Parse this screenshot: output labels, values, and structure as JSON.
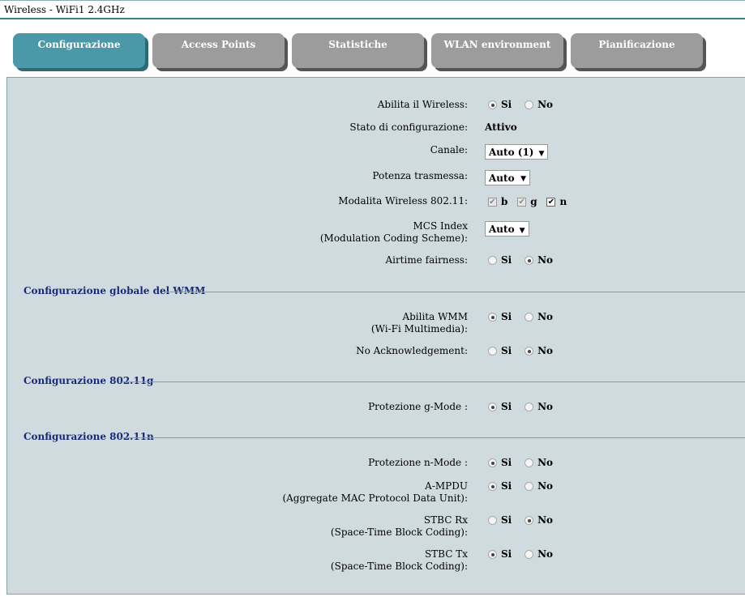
{
  "window_title": "Wireless - WiFi1 2.4GHz",
  "tabs": [
    {
      "label": "Configurazione",
      "active": true
    },
    {
      "label": "Access Points",
      "active": false
    },
    {
      "label": "Statistiche",
      "active": false
    },
    {
      "label": "WLAN environment",
      "active": false
    },
    {
      "label": "Pianificazione",
      "active": false
    }
  ],
  "options": {
    "yes": "Si",
    "no": "No"
  },
  "wireless": {
    "enable_label": "Abilita il Wireless:",
    "enable_value": "Si",
    "status_label": "Stato di configurazione:",
    "status_value": "Attivo",
    "channel_label": "Canale:",
    "channel_value": "Auto (1)",
    "power_label": "Potenza trasmessa:",
    "power_value": "Auto",
    "mode_label": "Modalita Wireless 802.11:",
    "mode_b": "b",
    "mode_g": "g",
    "mode_n": "n",
    "mcs_label_1": "MCS Index",
    "mcs_label_2": "(Modulation Coding Scheme):",
    "mcs_value": "Auto",
    "airtime_label": "Airtime fairness:",
    "airtime_value": "No"
  },
  "wmm": {
    "section_title": "Configurazione globale del WMM",
    "enable_label_1": "Abilita WMM",
    "enable_label_2": "(Wi-Fi Multimedia):",
    "enable_value": "Si",
    "noack_label": "No Acknowledgement:",
    "noack_value": "No"
  },
  "g": {
    "section_title": "Configurazione 802.11g",
    "protection_label": "Protezione g-Mode :",
    "protection_value": "Si"
  },
  "n": {
    "section_title": "Configurazione 802.11n",
    "protection_label": "Protezione n-Mode :",
    "protection_value": "Si",
    "ampdu_label_1": "A-MPDU",
    "ampdu_label_2": "(Aggregate MAC Protocol Data Unit):",
    "ampdu_value": "Si",
    "stbc_rx_label_1": "STBC Rx",
    "stbc_rx_label_2": "(Space-Time Block Coding):",
    "stbc_rx_value": "No",
    "stbc_tx_label_1": "STBC Tx",
    "stbc_tx_label_2": "(Space-Time Block Coding):",
    "stbc_tx_value": "Si"
  },
  "icons": {
    "dropdown": "triangle-down",
    "checkmark": "check"
  }
}
